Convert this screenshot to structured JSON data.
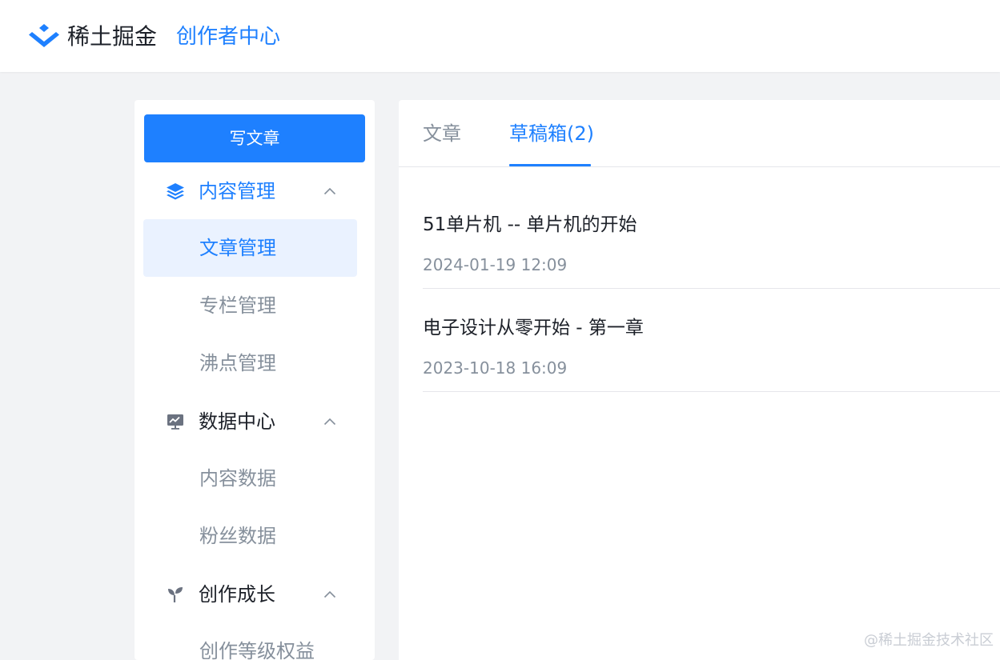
{
  "header": {
    "brand": "稀土掘金",
    "center_link": "创作者中心"
  },
  "sidebar": {
    "write_button": "写文章",
    "groups": [
      {
        "label": "内容管理",
        "icon": "layers-icon",
        "expanded": true,
        "items": [
          {
            "label": "文章管理",
            "active": true
          },
          {
            "label": "专栏管理",
            "active": false
          },
          {
            "label": "沸点管理",
            "active": false
          }
        ]
      },
      {
        "label": "数据中心",
        "icon": "chart-board-icon",
        "expanded": true,
        "items": [
          {
            "label": "内容数据",
            "active": false
          },
          {
            "label": "粉丝数据",
            "active": false
          }
        ]
      },
      {
        "label": "创作成长",
        "icon": "sprout-icon",
        "expanded": true,
        "items": [
          {
            "label": "创作等级权益",
            "active": false
          }
        ]
      }
    ]
  },
  "main": {
    "tabs": [
      {
        "label": "文章",
        "active": false
      },
      {
        "label": "草稿箱(2)",
        "active": true
      }
    ],
    "drafts": [
      {
        "title": "51单片机 -- 单片机的开始",
        "time": "2024-01-19 12:09"
      },
      {
        "title": "电子设计从零开始 - 第一章",
        "time": "2023-10-18 16:09"
      }
    ]
  },
  "watermark": "@稀土掘金技术社区",
  "colors": {
    "accent": "#1e80ff",
    "active_bg": "#eaf2ff",
    "text_primary": "#1d2129",
    "text_secondary": "#86909c",
    "page_bg": "#f2f3f5",
    "divider": "#e5e6eb"
  }
}
